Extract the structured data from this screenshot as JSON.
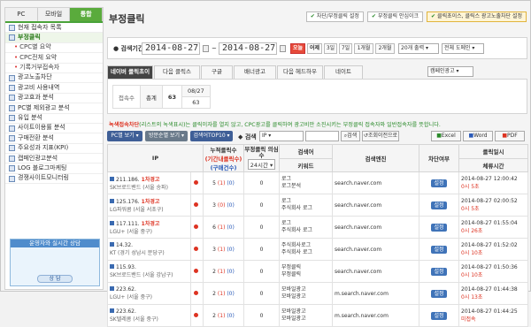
{
  "sidebar": {
    "tabs": [
      "PC",
      "모바일",
      "통합"
    ],
    "items": [
      {
        "label": "현재 접속자 목록",
        "sub": false,
        "on": false
      },
      {
        "label": "부정클릭",
        "sub": false,
        "on": true
      },
      {
        "label": "CPC별 요약",
        "sub": true,
        "on": false
      },
      {
        "label": "CPC전체 요약",
        "sub": true,
        "on": false
      },
      {
        "label": "기록거부접속자",
        "sub": true,
        "on": false
      },
      {
        "label": "광고노출차단",
        "sub": false,
        "on": false
      },
      {
        "label": "광고비 사용내역",
        "sub": false,
        "on": false
      },
      {
        "label": "광고효과 분석",
        "sub": false,
        "on": false
      },
      {
        "label": "PC별 제외광고 분석",
        "sub": false,
        "on": false
      },
      {
        "label": "유입 분석",
        "sub": false,
        "on": false
      },
      {
        "label": "사이트이용률 분석",
        "sub": false,
        "on": false
      },
      {
        "label": "구매전환 분석",
        "sub": false,
        "on": false
      },
      {
        "label": "주요성과 지표(KPI)",
        "sub": false,
        "on": false
      },
      {
        "label": "캡페인광고분석",
        "sub": false,
        "on": false
      },
      {
        "label": "LOG 블로그마케팅",
        "sub": false,
        "on": false
      },
      {
        "label": "경쟁사이트모니터링",
        "sub": false,
        "on": false
      }
    ],
    "counsel": {
      "title": "운영자와 실시간 상담",
      "button": "상 담"
    }
  },
  "header": {
    "title": "부정클릭",
    "buttons": [
      "차단/부정클릭 설정",
      "부정클릭 안심이크",
      "클릭초이스, 클릭스 광고노출차단 설정"
    ]
  },
  "datebar": {
    "label": "검색기간",
    "start": "2014-08-27",
    "sep": "~",
    "end": "2014-08-27",
    "quick": [
      "오늘",
      "어제",
      "3일",
      "7일",
      "1개월",
      "2개월"
    ],
    "per_page": "20개 출력",
    "domain": "전체 도메인"
  },
  "network_tabs": [
    "네이버 클릭초이스",
    "다음 클릭스",
    "구글",
    "배너광고",
    "다음 헤드하우",
    "네이트"
  ],
  "network_select": "캠페인광고",
  "stats": {
    "labels": [
      "접속수",
      "총계"
    ],
    "date": "08/27",
    "values": [
      "63",
      "63"
    ]
  },
  "notice": {
    "prefix": "녹색접속차단",
    "text": "(리스트의 녹색표시)는 클릭이자를 열지 않고, CPC광고를 클릭하여 광고비만 소진시키는 부정클릭 접속자와 일반접속자를 뜻합니다."
  },
  "toolbar": {
    "pc": "PC별 보기",
    "visit": "방문순별 보기",
    "search": "검색어TOP10",
    "search_sel": "검색",
    "search_field": "IP",
    "search_btn": "검색",
    "reset_btn": "조회이전으로",
    "excel": "Excel",
    "word": "Word",
    "pdf": "PDF"
  },
  "table": {
    "headers": {
      "ip": "IP",
      "cum": "누적클릭수",
      "cum2": "(기간내클릭수)",
      "cum3": "(구매건수)",
      "fraud": "부정클릭 의심수",
      "fraud_sel": "24시간",
      "search": "검색어",
      "keyword": "키워드",
      "engine": "검색엔진",
      "block": "차단여부",
      "time": "클릭일시",
      "stay": "체류시간"
    },
    "rows": [
      {
        "ip": "211.186.",
        "isp": "SK브로드밴드 (서울 송파)",
        "warn": "1차경고",
        "cum": "5",
        "period": "(1)",
        "buy": "(0)",
        "fraud": "0",
        "kw1": "로그",
        "kw2": "로그분석",
        "engine": "search.naver.com",
        "btn": "설정",
        "time": "2014-08-27 12:00:42",
        "ago": "0시 5초"
      },
      {
        "ip": "125.176.",
        "isp": "LG파워콤 (서울 서초구)",
        "warn": "1차경고",
        "cum": "3",
        "period": "(0)",
        "buy": "(0)",
        "fraud": "0",
        "kw1": "로그",
        "kw2": "주식회사 로그",
        "engine": "search.naver.com",
        "btn": "설정",
        "time": "2014-08-27 02:00:52",
        "ago": "0시 5초"
      },
      {
        "ip": "117.111.",
        "isp": "LGU+ (서울 중구)",
        "warn": "1차경고",
        "cum": "6",
        "period": "(1)",
        "buy": "(0)",
        "fraud": "0",
        "kw1": "로그",
        "kw2": "주식회사 로그",
        "engine": "search.naver.com",
        "btn": "설정",
        "time": "2014-08-27 01:55:04",
        "ago": "0시 26초"
      },
      {
        "ip": "14.32.",
        "isp": "KT (경기 성남시 분당구)",
        "warn": "",
        "cum": "3",
        "period": "(1)",
        "buy": "(0)",
        "fraud": "0",
        "kw1": "주식회사로그",
        "kw2": "주식회사 로그",
        "engine": "search.naver.com",
        "btn": "설정",
        "time": "2014-08-27 01:52:02",
        "ago": "0시 10초"
      },
      {
        "ip": "115.93.",
        "isp": "SK브로드밴드 (서울 강남구)",
        "warn": "",
        "cum": "2",
        "period": "(1)",
        "buy": "(0)",
        "fraud": "0",
        "kw1": "부정클릭",
        "kw2": "부정클릭",
        "engine": "search.naver.com",
        "btn": "설정",
        "time": "2014-08-27 01:50:36",
        "ago": "0시 10초"
      },
      {
        "ip": "223.62.",
        "isp": "LGU+ (서울 중구)",
        "warn": "",
        "cum": "2",
        "period": "(1)",
        "buy": "(0)",
        "fraud": "0",
        "kw1": "모바일광고",
        "kw2": "모바일광고",
        "engine": "m.search.naver.com",
        "btn": "설정",
        "time": "2014-08-27 01:44:38",
        "ago": "0시 13초"
      },
      {
        "ip": "223.62.",
        "isp": "SK텔레콤 (서울 중구)",
        "warn": "",
        "cum": "2",
        "period": "(1)",
        "buy": "(0)",
        "fraud": "0",
        "kw1": "모바일광고",
        "kw2": "모바일광고",
        "engine": "m.search.naver.com",
        "btn": "설정",
        "time": "2014-08-27 01:44:25",
        "ago": "미접속"
      }
    ]
  }
}
